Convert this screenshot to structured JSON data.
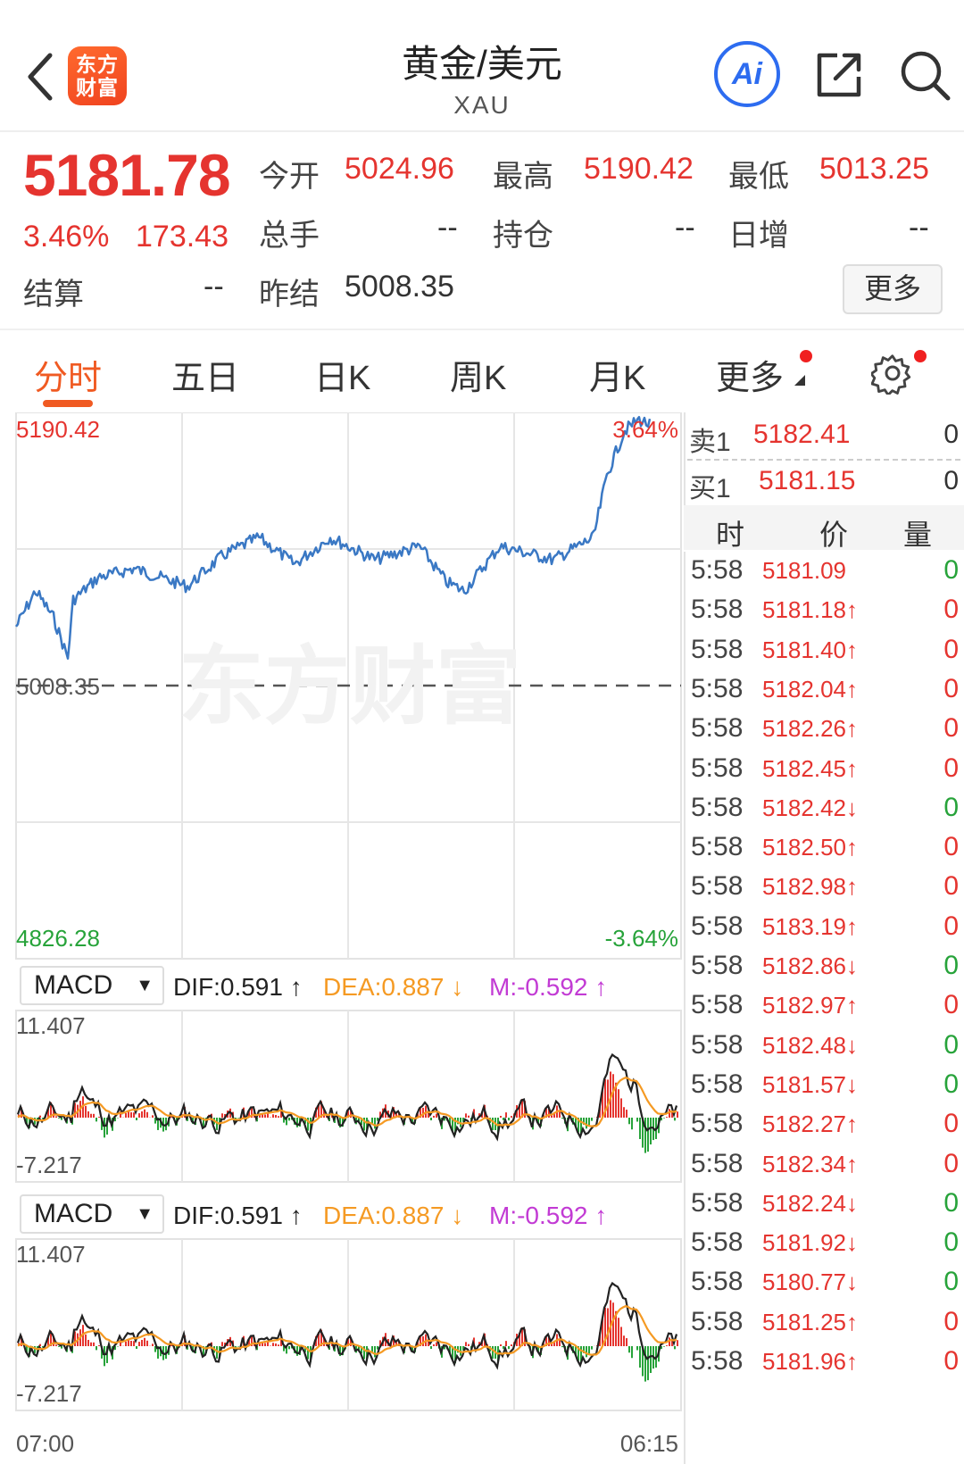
{
  "header": {
    "logo_text": "东方财富",
    "title": "黄金/美元",
    "subtitle": "XAU",
    "ai_label": "Ai"
  },
  "quote": {
    "price": "5181.78",
    "change_pct": "3.46%",
    "change_abs": "173.43",
    "labels": {
      "open": "今开",
      "high": "最高",
      "low": "最低",
      "volume": "总手",
      "position": "持仓",
      "daily_inc": "日增",
      "settle": "结算",
      "prev_settle": "昨结"
    },
    "values": {
      "open": "5024.96",
      "high": "5190.42",
      "low": "5013.25",
      "volume": "--",
      "position": "--",
      "daily_inc": "--",
      "settle": "--",
      "prev_settle": "5008.35"
    },
    "more_label": "更多"
  },
  "tabs": [
    "分时",
    "五日",
    "日K",
    "周K",
    "月K",
    "更多"
  ],
  "chart": {
    "y_max_label": "5190.42",
    "y_mid_label": "5008.35",
    "y_min_label": "4826.28",
    "pct_max_label": "3.64%",
    "pct_min_label": "-3.64%",
    "watermark": "东方财富",
    "time_start": "07:00",
    "time_end": "06:15"
  },
  "macd": [
    {
      "select_label": "MACD",
      "dif": "DIF:0.591 ↑",
      "dea": "DEA:0.887 ↓",
      "m": "M:-0.592 ↑",
      "y_max": "11.407",
      "y_min": "-7.217"
    },
    {
      "select_label": "MACD",
      "dif": "DIF:0.591 ↑",
      "dea": "DEA:0.887 ↓",
      "m": "M:-0.592 ↑",
      "y_max": "11.407",
      "y_min": "-7.217"
    }
  ],
  "order_book": {
    "sell": {
      "label": "卖1",
      "price": "5182.41",
      "qty": "0"
    },
    "buy": {
      "label": "买1",
      "price": "5181.15",
      "qty": "0"
    },
    "headers": {
      "time": "时",
      "price": "价",
      "qty": "量"
    }
  },
  "ticks": [
    {
      "time": "5:58",
      "price": "5181.09",
      "dir": "",
      "qty": "0",
      "color": "red",
      "qty_color": "green"
    },
    {
      "time": "5:58",
      "price": "5181.18↑",
      "dir": "up",
      "qty": "0",
      "color": "red",
      "qty_color": "red"
    },
    {
      "time": "5:58",
      "price": "5181.40↑",
      "dir": "up",
      "qty": "0",
      "color": "red",
      "qty_color": "red"
    },
    {
      "time": "5:58",
      "price": "5182.04↑",
      "dir": "up",
      "qty": "0",
      "color": "red",
      "qty_color": "red"
    },
    {
      "time": "5:58",
      "price": "5182.26↑",
      "dir": "up",
      "qty": "0",
      "color": "red",
      "qty_color": "red"
    },
    {
      "time": "5:58",
      "price": "5182.45↑",
      "dir": "up",
      "qty": "0",
      "color": "red",
      "qty_color": "red"
    },
    {
      "time": "5:58",
      "price": "5182.42↓",
      "dir": "down",
      "qty": "0",
      "color": "red",
      "qty_color": "green"
    },
    {
      "time": "5:58",
      "price": "5182.50↑",
      "dir": "up",
      "qty": "0",
      "color": "red",
      "qty_color": "red"
    },
    {
      "time": "5:58",
      "price": "5182.98↑",
      "dir": "up",
      "qty": "0",
      "color": "red",
      "qty_color": "red"
    },
    {
      "time": "5:58",
      "price": "5183.19↑",
      "dir": "up",
      "qty": "0",
      "color": "red",
      "qty_color": "red"
    },
    {
      "time": "5:58",
      "price": "5182.86↓",
      "dir": "down",
      "qty": "0",
      "color": "red",
      "qty_color": "green"
    },
    {
      "time": "5:58",
      "price": "5182.97↑",
      "dir": "up",
      "qty": "0",
      "color": "red",
      "qty_color": "red"
    },
    {
      "time": "5:58",
      "price": "5182.48↓",
      "dir": "down",
      "qty": "0",
      "color": "red",
      "qty_color": "green"
    },
    {
      "time": "5:58",
      "price": "5181.57↓",
      "dir": "down",
      "qty": "0",
      "color": "red",
      "qty_color": "green"
    },
    {
      "time": "5:58",
      "price": "5182.27↑",
      "dir": "up",
      "qty": "0",
      "color": "red",
      "qty_color": "red"
    },
    {
      "time": "5:58",
      "price": "5182.34↑",
      "dir": "up",
      "qty": "0",
      "color": "red",
      "qty_color": "red"
    },
    {
      "time": "5:58",
      "price": "5182.24↓",
      "dir": "down",
      "qty": "0",
      "color": "red",
      "qty_color": "green"
    },
    {
      "time": "5:58",
      "price": "5181.92↓",
      "dir": "down",
      "qty": "0",
      "color": "red",
      "qty_color": "green"
    },
    {
      "time": "5:58",
      "price": "5180.77↓",
      "dir": "down",
      "qty": "0",
      "color": "red",
      "qty_color": "green"
    },
    {
      "time": "5:58",
      "price": "5181.25↑",
      "dir": "up",
      "qty": "0",
      "color": "red",
      "qty_color": "red"
    },
    {
      "time": "5:58",
      "price": "5181.96↑",
      "dir": "up",
      "qty": "0",
      "color": "red",
      "qty_color": "red"
    }
  ],
  "colors": {
    "up": "#e5342f",
    "down": "#27a33a",
    "accent": "#f05a22",
    "line": "#3a78c4",
    "dea": "#f59a23",
    "m": "#c23bd4"
  }
}
